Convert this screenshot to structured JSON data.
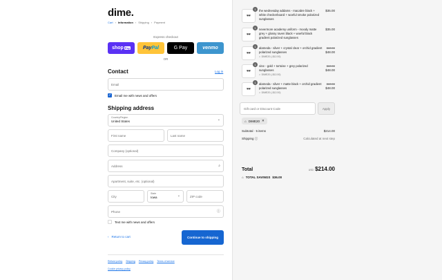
{
  "logo": "dime.",
  "breadcrumb": [
    "Cart",
    "Information",
    "Shipping",
    "Payment"
  ],
  "express_checkout": "Express checkout",
  "pay_buttons": {
    "shop": "shop",
    "shop_suffix": "Pay",
    "paypal_a": "Pay",
    "paypal_b": "Pal",
    "gpay": "G Pay",
    "venmo": "venmo"
  },
  "or_label": "OR",
  "contact": {
    "heading": "Contact",
    "login": "Log in",
    "email_placeholder": "Email",
    "email_news": "Email me with news and offers"
  },
  "shipping": {
    "heading": "Shipping address",
    "country_label": "Country/Region",
    "country_value": "United States",
    "first_name": "First name",
    "last_name": "Last name",
    "company": "Company (optional)",
    "address": "Address",
    "apartment": "Apartment, suite, etc. (optional)",
    "city": "City",
    "state_label": "State",
    "state_value": "Iowa",
    "zip": "ZIP code",
    "phone": "Phone",
    "text_news": "Text me with news and offers"
  },
  "return_to_cart": "Return to cart",
  "continue_button": "Continue to shipping",
  "footer_links": [
    "Refund policy",
    "Shipping",
    "Privacy policy",
    "Terms of service"
  ],
  "cookie_link": "Cookie privacy policy",
  "order": {
    "items": [
      {
        "qty": "1",
        "name": "the wednesday addams - macabre black + white checkerboard + woeful smoke polarized sunglasses",
        "price": "$35.00"
      },
      {
        "qty": "1",
        "name": "nevermore academy uniform - moody matte grey + glossy raven black + woeful black gradient polarized sunglasses",
        "price": "$35.00"
      },
      {
        "qty": "1",
        "name": "alameda - silver + crystal clear + orchid gradient polarized sunglasses",
        "discount": "DIME20 (-$12.00)",
        "old_price": "$60.00",
        "price": "$48.00"
      },
      {
        "qty": "1",
        "name": "vine - gold + tortoise + grey polarized sunglasses",
        "discount": "DIME20 (-$12.00)",
        "old_price": "$60.00",
        "price": "$48.00"
      },
      {
        "qty": "1",
        "name": "alameda - silver + matte black + orchid gradient polarized sunglasses",
        "discount": "DIME20 (-$12.00)",
        "old_price": "$60.00",
        "price": "$48.00"
      }
    ],
    "gift_placeholder": "Gift card or Discount Code",
    "apply": "Apply",
    "applied_code": "DIME20",
    "subtotal_label": "Subtotal · 5 items",
    "subtotal_value": "$214.00",
    "shipping_label": "Shipping",
    "shipping_value": "Calculated at next step",
    "total_label": "Total",
    "currency": "USD",
    "total_value": "$214.00",
    "savings_label": "TOTAL SAVINGS",
    "savings_value": "$36.00"
  }
}
